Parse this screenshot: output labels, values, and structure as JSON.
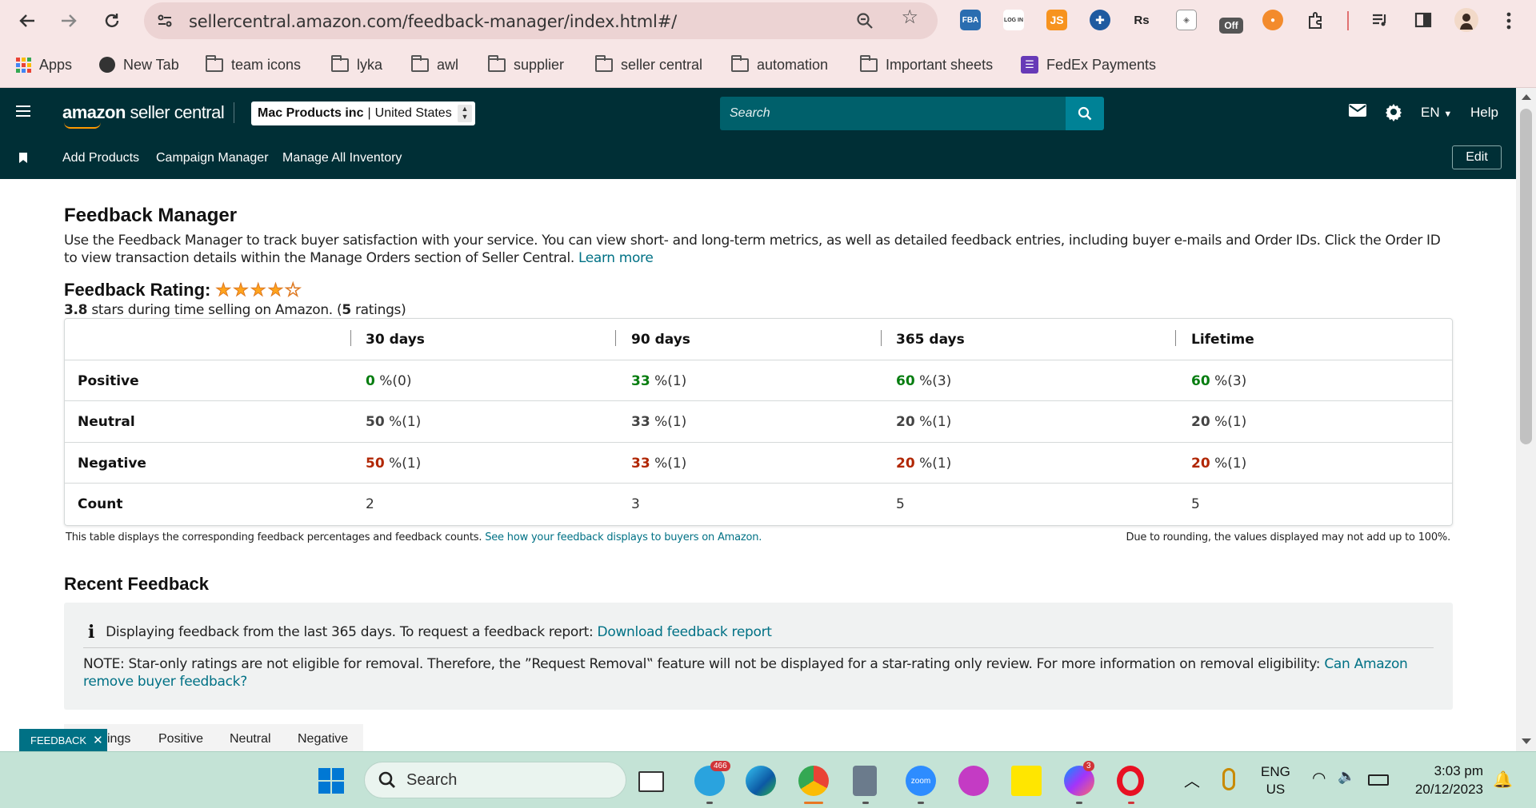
{
  "browser": {
    "url": "sellercentral.amazon.com/feedback-manager/index.html#/",
    "bookmarks": [
      "Apps",
      "New Tab",
      "team icons",
      "lyka",
      "awl",
      "supplier",
      "seller central",
      "automation",
      "Important sheets",
      "FedEx Payments"
    ],
    "extensions": {
      "fba": "FBA",
      "login": "LOG IN",
      "js": "JS",
      "rs": "Rs",
      "off": "Off"
    }
  },
  "header": {
    "logo": "amazon seller central",
    "logo_bold": "amazon",
    "logo_rest": " seller central",
    "account_name": "Mac Products inc",
    "account_region": "United States",
    "search_placeholder": "Search",
    "language": "EN",
    "help": "Help"
  },
  "nav": {
    "items": [
      "Add Products",
      "Campaign Manager",
      "Manage All Inventory"
    ],
    "edit": "Edit"
  },
  "page": {
    "title": "Feedback Manager",
    "description": "Use the Feedback Manager to track buyer satisfaction with your service. You can view short- and long-term metrics, as well as detailed feedback entries, including buyer e-mails and Order IDs. Click the Order ID to view transaction details within the Manage Orders section of Seller Central.",
    "learn_more": "Learn more",
    "rating_label": "Feedback Rating:",
    "rating_value": "3.8",
    "rating_text": " stars during time selling on Amazon. (",
    "rating_count": "5",
    "rating_count_suffix": " ratings)",
    "stars_filled": 4,
    "stars_total": 5
  },
  "table": {
    "columns": [
      "30 days",
      "90 days",
      "365 days",
      "Lifetime"
    ],
    "rows": [
      {
        "label": "Positive",
        "cells": [
          [
            "0",
            " %(0)"
          ],
          [
            "33",
            " %(1)"
          ],
          [
            "60",
            " %(3)"
          ],
          [
            "60",
            " %(3)"
          ]
        ]
      },
      {
        "label": "Neutral",
        "cells": [
          [
            "50",
            " %(1)"
          ],
          [
            "33",
            " %(1)"
          ],
          [
            "20",
            " %(1)"
          ],
          [
            "20",
            " %(1)"
          ]
        ]
      },
      {
        "label": "Negative",
        "cells": [
          [
            "50",
            " %(1)"
          ],
          [
            "33",
            " %(1)"
          ],
          [
            "20",
            " %(1)"
          ],
          [
            "20",
            " %(1)"
          ]
        ]
      },
      {
        "label": "Count",
        "cells": [
          [
            "2",
            ""
          ],
          [
            "3",
            ""
          ],
          [
            "5",
            ""
          ],
          [
            "5",
            ""
          ]
        ]
      }
    ],
    "note": "This table displays the corresponding feedback percentages and feedback counts.",
    "note_link": "See how your feedback displays to buyers on Amazon.",
    "rounding_note": "Due to rounding, the values displayed may not add up to 100%."
  },
  "recent": {
    "title": "Recent Feedback",
    "info": "Displaying feedback from the last 365 days. To request a feedback report:",
    "download_link": "Download feedback report",
    "note": "NOTE: Star-only ratings are not eligible for removal. Therefore, the ”Request Removal‟ feature will not be displayed for a star-rating only review. For more information on removal eligibility:",
    "note_link": "Can Amazon remove buyer feedback?",
    "tabs": [
      "ings",
      "Positive",
      "Neutral",
      "Negative"
    ],
    "feedback_badge": "FEEDBACK"
  },
  "taskbar": {
    "search": "Search",
    "telegram_badge": "466",
    "messenger_badge": "3",
    "zoom": "zoom",
    "lang_top": "ENG",
    "lang_bottom": "US",
    "time": "3:03 pm",
    "date": "20/12/2023"
  },
  "colors": {
    "header_bg": "#002f36",
    "link": "#007185",
    "positive": "#067d10",
    "negative": "#b12704",
    "star": "#ffa41c",
    "chrome_bg": "#f7e6e6",
    "taskbar_bg": "#c4e3d6"
  }
}
